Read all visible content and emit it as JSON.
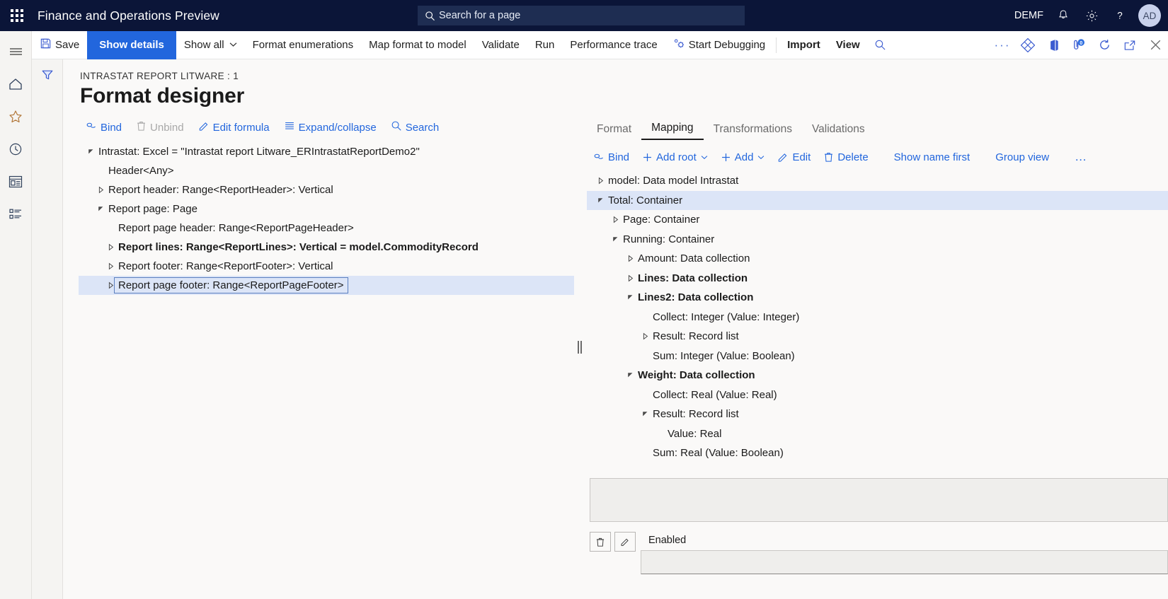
{
  "topbar": {
    "waffle_icon": "waffle-grid-icon",
    "app_title": "Finance and Operations Preview",
    "search": {
      "icon": "search-icon",
      "placeholder": "Search for a page",
      "value": ""
    },
    "company": "DEMF",
    "notifications_icon": "bell-icon",
    "settings_icon": "gear-icon",
    "help_icon": "question-mark-icon",
    "avatar_initials": "AD",
    "bg_color": "#0b1538",
    "search_bg": "#1e2d52"
  },
  "rail": {
    "items": [
      {
        "icon": "hamburger-menu-icon",
        "name": "nav-expand"
      },
      {
        "icon": "home-icon",
        "name": "home"
      },
      {
        "icon": "star-icon",
        "name": "favorites"
      },
      {
        "icon": "clock-icon",
        "name": "recent"
      },
      {
        "icon": "workspace-icon",
        "name": "workspaces"
      },
      {
        "icon": "modules-list-icon",
        "name": "modules"
      }
    ]
  },
  "commandbar": {
    "save_label": "Save",
    "save_icon": "save-disk-icon",
    "show_details_label": "Show details",
    "show_all_label": "Show all",
    "show_all_chevron": "chevron-down-icon",
    "format_enumerations_label": "Format enumerations",
    "map_format_to_model_label": "Map format to model",
    "validate_label": "Validate",
    "run_label": "Run",
    "performance_trace_label": "Performance trace",
    "start_debugging_label": "Start Debugging",
    "start_debugging_icon": "debug-gear-icon",
    "import_label": "Import",
    "view_label": "View",
    "search_icon": "search-icon",
    "overflow_icon": "ellipsis-icon",
    "office_addin_icon": "diamond-app-icon",
    "open_in_office_icon": "office-icon",
    "attachments_icon": "attachment-icon",
    "attachments_count": "0",
    "refresh_icon": "refresh-icon",
    "popout_icon": "open-in-new-window-icon",
    "close_icon": "close-x-icon",
    "primary_color": "#2266dd"
  },
  "filter_strip": {
    "icon": "filter-funnel-icon"
  },
  "page": {
    "breadcrumb": "INTRASTAT REPORT LITWARE : 1",
    "title": "Format designer"
  },
  "left_pane": {
    "actions": [
      {
        "label": "Bind",
        "icon": "bind-link-icon",
        "disabled": false
      },
      {
        "label": "Unbind",
        "icon": "trash-icon",
        "disabled": true
      },
      {
        "label": "Edit formula",
        "icon": "pencil-icon",
        "disabled": false
      },
      {
        "label": "Expand/collapse",
        "icon": "list-lines-icon",
        "disabled": false
      },
      {
        "label": "Search",
        "icon": "search-icon",
        "disabled": false
      }
    ],
    "tree": [
      {
        "label": "Intrastat: Excel = \"Intrastat report Litware_ERIntrastatReportDemo2\"",
        "indent": 0,
        "twisty": "expanded",
        "bold": false,
        "selected": false
      },
      {
        "label": "Header<Any>",
        "indent": 1,
        "twisty": "none",
        "bold": false,
        "selected": false
      },
      {
        "label": "Report header: Range<ReportHeader>: Vertical",
        "indent": 1,
        "twisty": "collapsed",
        "bold": false,
        "selected": false
      },
      {
        "label": "Report page: Page",
        "indent": 1,
        "twisty": "expanded",
        "bold": false,
        "selected": false
      },
      {
        "label": "Report page header: Range<ReportPageHeader>",
        "indent": 2,
        "twisty": "none",
        "bold": false,
        "selected": false
      },
      {
        "label": "Report lines: Range<ReportLines>: Vertical = model.CommodityRecord",
        "indent": 2,
        "twisty": "collapsed",
        "bold": true,
        "selected": false
      },
      {
        "label": "Report footer: Range<ReportFooter>: Vertical",
        "indent": 2,
        "twisty": "collapsed",
        "bold": false,
        "selected": false
      },
      {
        "label": "Report page footer: Range<ReportPageFooter>",
        "indent": 2,
        "twisty": "collapsed",
        "bold": false,
        "selected": true
      }
    ]
  },
  "right_pane": {
    "tabs": [
      {
        "label": "Format",
        "active": false
      },
      {
        "label": "Mapping",
        "active": true
      },
      {
        "label": "Transformations",
        "active": false
      },
      {
        "label": "Validations",
        "active": false
      }
    ],
    "actions": [
      {
        "label": "Bind",
        "icon": "bind-link-icon",
        "chevron": false
      },
      {
        "label": "Add root",
        "icon": "plus-icon",
        "chevron": true
      },
      {
        "label": "Add",
        "icon": "plus-icon",
        "chevron": true
      },
      {
        "label": "Edit",
        "icon": "pencil-icon",
        "chevron": false
      },
      {
        "label": "Delete",
        "icon": "trash-icon",
        "chevron": false
      },
      {
        "label": "Show name first",
        "icon": "none",
        "chevron": false
      },
      {
        "label": "Group view",
        "icon": "none",
        "chevron": false
      },
      {
        "label": "…",
        "icon": "ellipsis-icon",
        "chevron": false
      }
    ],
    "tree": [
      {
        "label": "model: Data model Intrastat",
        "indent": 0,
        "twisty": "collapsed",
        "bold": false,
        "selected": false
      },
      {
        "label": "Total: Container",
        "indent": 0,
        "twisty": "expanded",
        "bold": false,
        "selected": true
      },
      {
        "label": "Page: Container",
        "indent": 1,
        "twisty": "collapsed",
        "bold": false,
        "selected": false
      },
      {
        "label": "Running: Container",
        "indent": 1,
        "twisty": "expanded",
        "bold": false,
        "selected": false
      },
      {
        "label": "Amount: Data collection",
        "indent": 2,
        "twisty": "collapsed",
        "bold": false,
        "selected": false
      },
      {
        "label": "Lines: Data collection",
        "indent": 2,
        "twisty": "collapsed",
        "bold": true,
        "selected": false
      },
      {
        "label": "Lines2: Data collection",
        "indent": 2,
        "twisty": "expanded",
        "bold": true,
        "selected": false
      },
      {
        "label": "Collect: Integer (Value: Integer)",
        "indent": 3,
        "twisty": "none",
        "bold": false,
        "selected": false
      },
      {
        "label": "Result: Record list",
        "indent": 3,
        "twisty": "collapsed",
        "bold": false,
        "selected": false
      },
      {
        "label": "Sum: Integer (Value: Boolean)",
        "indent": 3,
        "twisty": "none",
        "bold": false,
        "selected": false
      },
      {
        "label": "Weight: Data collection",
        "indent": 2,
        "twisty": "expanded",
        "bold": true,
        "selected": false
      },
      {
        "label": "Collect: Real (Value: Real)",
        "indent": 3,
        "twisty": "none",
        "bold": false,
        "selected": false
      },
      {
        "label": "Result: Record list",
        "indent": 3,
        "twisty": "expanded",
        "bold": false,
        "selected": false
      },
      {
        "label": "Value: Real",
        "indent": 4,
        "twisty": "none",
        "bold": false,
        "selected": false
      },
      {
        "label": "Sum: Real (Value: Boolean)",
        "indent": 3,
        "twisty": "none",
        "bold": false,
        "selected": false
      }
    ],
    "formula_box": {
      "value": ""
    },
    "bottom": {
      "delete_icon": "trash-icon",
      "edit_icon": "pencil-icon",
      "enabled_label": "Enabled",
      "enabled_value": ""
    }
  }
}
